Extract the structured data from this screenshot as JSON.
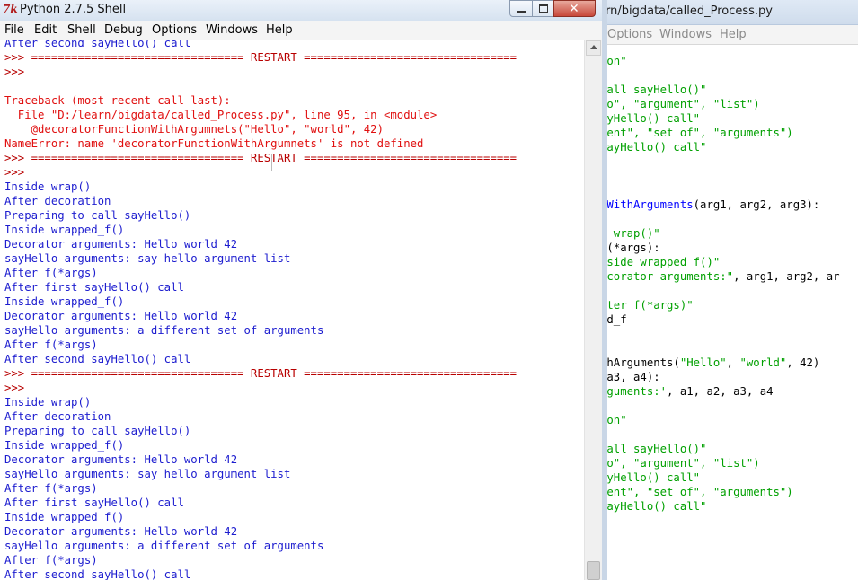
{
  "editor": {
    "title": "rn/bigdata/called_Process.py",
    "menu": [
      "Options",
      "Windows",
      "Help"
    ],
    "lines": [
      [
        {
          "t": "ion\"",
          "c": "str"
        }
      ],
      [],
      [
        {
          "t": "call sayHello()\"",
          "c": "str"
        }
      ],
      [
        {
          "t": "lo\", \"argument\", \"list\")",
          "c": "str"
        }
      ],
      [
        {
          "t": "ayHello() call\"",
          "c": "str"
        }
      ],
      [
        {
          "t": "rent\", \"set of\", \"arguments\")",
          "c": "str"
        }
      ],
      [
        {
          "t": "sayHello() call\"",
          "c": "str"
        }
      ],
      [],
      [],
      [],
      [
        {
          "t": "nWithArguments",
          "c": "def"
        },
        {
          "t": "(arg1, arg2, arg3):",
          "c": ""
        }
      ],
      [],
      [
        {
          "t": "e wrap()\"",
          "c": "str"
        }
      ],
      [
        {
          "t": "f(*args):",
          "c": ""
        }
      ],
      [
        {
          "t": "nside wrapped_f()\"",
          "c": "str"
        }
      ],
      [
        {
          "t": "ecorator arguments:\"",
          "c": "str"
        },
        {
          "t": ", arg1, arg2, ar",
          "c": ""
        }
      ],
      [],
      [
        {
          "t": "fter f(*args)\"",
          "c": "str"
        }
      ],
      [
        {
          "t": "ed_f",
          "c": ""
        }
      ],
      [],
      [],
      [
        {
          "t": "thArguments(",
          "c": ""
        },
        {
          "t": "\"Hello\"",
          "c": "str"
        },
        {
          "t": ", ",
          "c": ""
        },
        {
          "t": "\"world\"",
          "c": "str"
        },
        {
          "t": ", 42)",
          "c": ""
        }
      ],
      [
        {
          "t": " a3, a4):",
          "c": ""
        }
      ],
      [
        {
          "t": "rguments:'",
          "c": "str"
        },
        {
          "t": ", a1, a2, a3, a4",
          "c": ""
        }
      ],
      [],
      [
        {
          "t": "ion\"",
          "c": "str"
        }
      ],
      [],
      [
        {
          "t": "call sayHello()\"",
          "c": "str"
        }
      ],
      [
        {
          "t": "lo\", \"argument\", \"list\")",
          "c": "str"
        }
      ],
      [
        {
          "t": "ayHello() call\"",
          "c": "str"
        }
      ],
      [
        {
          "t": "rent\", \"set of\", \"arguments\")",
          "c": "str"
        }
      ],
      [
        {
          "t": "sayHello() call\"",
          "c": "str"
        }
      ]
    ]
  },
  "shell": {
    "title": "Python 2.7.5 Shell",
    "app_icon": "7k",
    "menu": [
      "File",
      "Edit",
      "Shell",
      "Debug",
      "Options",
      "Windows",
      "Help"
    ],
    "window_controls": {
      "close_glyph": "✕"
    },
    "lines": [
      {
        "t": "After second sayHello() call",
        "c": "out"
      },
      {
        "t": ">>> ================================ RESTART ================================",
        "c": "prompt"
      },
      {
        "t": ">>> ",
        "c": "prompt"
      },
      {
        "t": "",
        "c": "out"
      },
      {
        "t": "Traceback (most recent call last):",
        "c": "err"
      },
      {
        "t": "  File \"D:/learn/bigdata/called_Process.py\", line 95, in <module>",
        "c": "err"
      },
      {
        "t": "    @decoratorFunctionWithArgumnets(\"Hello\", \"world\", 42)",
        "c": "err"
      },
      {
        "t": "NameError: name 'decoratorFunctionWithArgumnets' is not defined",
        "c": "err"
      },
      {
        "t": ">>> ================================ RESTART ================================",
        "c": "prompt"
      },
      {
        "t": ">>> ",
        "c": "prompt"
      },
      {
        "t": "Inside wrap()",
        "c": "out"
      },
      {
        "t": "After decoration",
        "c": "out"
      },
      {
        "t": "Preparing to call sayHello()",
        "c": "out"
      },
      {
        "t": "Inside wrapped_f()",
        "c": "out"
      },
      {
        "t": "Decorator arguments: Hello world 42",
        "c": "out"
      },
      {
        "t": "sayHello arguments: say hello argument list",
        "c": "out"
      },
      {
        "t": "After f(*args)",
        "c": "out"
      },
      {
        "t": "After first sayHello() call",
        "c": "out"
      },
      {
        "t": "Inside wrapped_f()",
        "c": "out"
      },
      {
        "t": "Decorator arguments: Hello world 42",
        "c": "out"
      },
      {
        "t": "sayHello arguments: a different set of arguments",
        "c": "out"
      },
      {
        "t": "After f(*args)",
        "c": "out"
      },
      {
        "t": "After second sayHello() call",
        "c": "out"
      },
      {
        "t": ">>> ================================ RESTART ================================",
        "c": "prompt"
      },
      {
        "t": ">>> ",
        "c": "prompt"
      },
      {
        "t": "Inside wrap()",
        "c": "out"
      },
      {
        "t": "After decoration",
        "c": "out"
      },
      {
        "t": "Preparing to call sayHello()",
        "c": "out"
      },
      {
        "t": "Inside wrapped_f()",
        "c": "out"
      },
      {
        "t": "Decorator arguments: Hello world 42",
        "c": "out"
      },
      {
        "t": "sayHello arguments: say hello argument list",
        "c": "out"
      },
      {
        "t": "After f(*args)",
        "c": "out"
      },
      {
        "t": "After first sayHello() call",
        "c": "out"
      },
      {
        "t": "Inside wrapped_f()",
        "c": "out"
      },
      {
        "t": "Decorator arguments: Hello world 42",
        "c": "out"
      },
      {
        "t": "sayHello arguments: a different set of arguments",
        "c": "out"
      },
      {
        "t": "After f(*args)",
        "c": "out"
      },
      {
        "t": "After second sayHello() call",
        "c": "out"
      }
    ]
  },
  "colors": {
    "prompt": "#b80000",
    "output": "#1d1dcf",
    "error": "#e01010",
    "string": "#00a000",
    "keyword_def": "#0000ff"
  }
}
